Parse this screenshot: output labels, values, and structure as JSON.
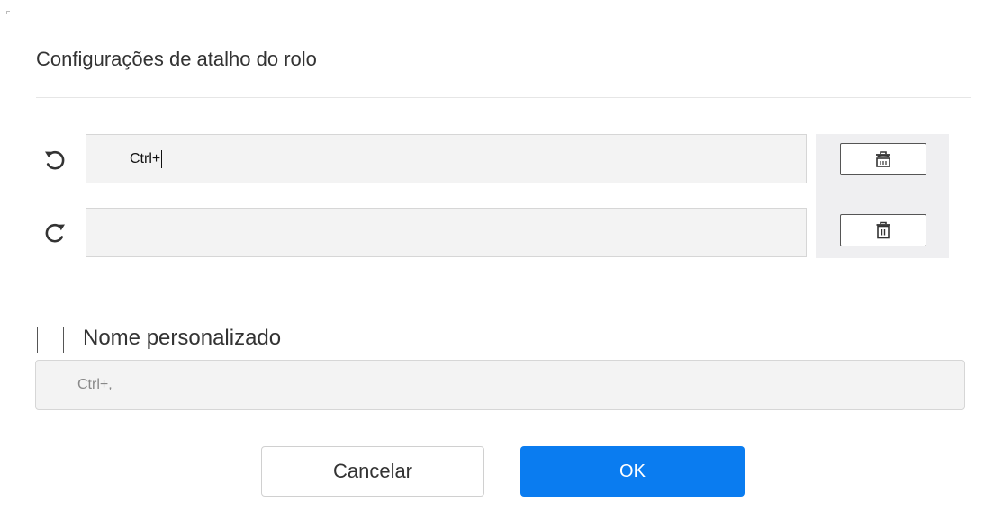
{
  "dialog": {
    "title": "Configurações de atalho do rolo"
  },
  "shortcuts": [
    {
      "icon": "rotate-counterclockwise-icon",
      "value": "Ctrl+",
      "focused": true,
      "delete_icon": "trash-icon"
    },
    {
      "icon": "rotate-clockwise-icon",
      "value": "",
      "focused": false,
      "delete_icon": "trash-icon"
    }
  ],
  "custom_name": {
    "checkbox_label": "Nome personalizado",
    "checked": false,
    "value": "Ctrl+,"
  },
  "buttons": {
    "cancel_label": "Cancelar",
    "ok_label": "OK"
  },
  "colors": {
    "ok_button": "#0a7cf0",
    "field_background": "#f3f3f3",
    "panel_background": "#efeff1"
  }
}
